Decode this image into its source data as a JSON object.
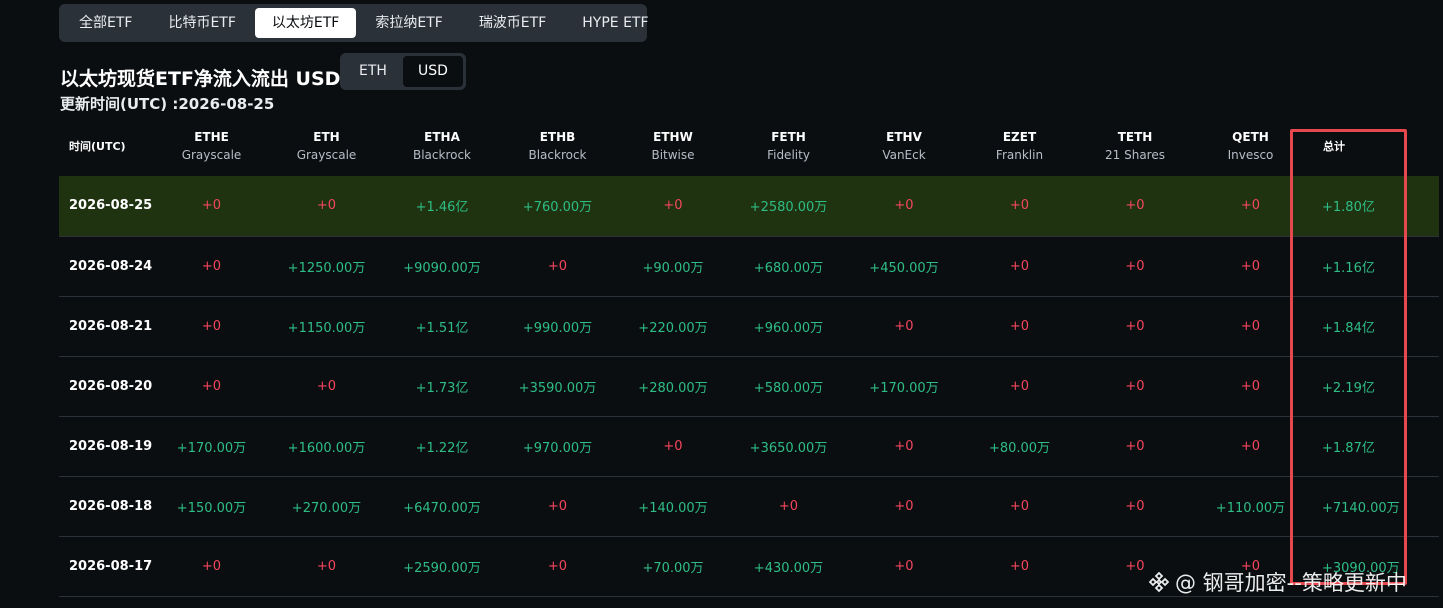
{
  "tabs": [
    {
      "label": "全部ETF",
      "active": false
    },
    {
      "label": "比特币ETF",
      "active": false
    },
    {
      "label": "以太坊ETF",
      "active": true
    },
    {
      "label": "索拉纳ETF",
      "active": false
    },
    {
      "label": "瑞波币ETF",
      "active": false
    },
    {
      "label": "HYPE ETF",
      "active": false
    }
  ],
  "title": "以太坊现货ETF净流入流出 USD",
  "currency_toggle": {
    "options": [
      "ETH",
      "USD"
    ],
    "selected": "USD"
  },
  "updated": "更新时间(UTC) :2026-08-25",
  "table": {
    "date_header": "时间(UTC)",
    "total_header": "总计",
    "columns": [
      {
        "code": "ETHE",
        "issuer": "Grayscale"
      },
      {
        "code": "ETH",
        "issuer": "Grayscale"
      },
      {
        "code": "ETHA",
        "issuer": "Blackrock"
      },
      {
        "code": "ETHB",
        "issuer": "Blackrock"
      },
      {
        "code": "ETHW",
        "issuer": "Bitwise"
      },
      {
        "code": "FETH",
        "issuer": "Fidelity"
      },
      {
        "code": "ETHV",
        "issuer": "VanEck"
      },
      {
        "code": "EZET",
        "issuer": "Franklin"
      },
      {
        "code": "TETH",
        "issuer": "21 Shares"
      },
      {
        "code": "QETH",
        "issuer": "Invesco"
      }
    ],
    "rows": [
      {
        "date": "2026-08-25",
        "values": [
          "+0",
          "+0",
          "+1.46亿",
          "+760.00万",
          "+0",
          "+2580.00万",
          "+0",
          "+0",
          "+0",
          "+0"
        ],
        "total": "+1.80亿"
      },
      {
        "date": "2026-08-24",
        "values": [
          "+0",
          "+1250.00万",
          "+9090.00万",
          "+0",
          "+90.00万",
          "+680.00万",
          "+450.00万",
          "+0",
          "+0",
          "+0"
        ],
        "total": "+1.16亿"
      },
      {
        "date": "2026-08-21",
        "values": [
          "+0",
          "+1150.00万",
          "+1.51亿",
          "+990.00万",
          "+220.00万",
          "+960.00万",
          "+0",
          "+0",
          "+0",
          "+0"
        ],
        "total": "+1.84亿"
      },
      {
        "date": "2026-08-20",
        "values": [
          "+0",
          "+0",
          "+1.73亿",
          "+3590.00万",
          "+280.00万",
          "+580.00万",
          "+170.00万",
          "+0",
          "+0",
          "+0"
        ],
        "total": "+2.19亿"
      },
      {
        "date": "2026-08-19",
        "values": [
          "+170.00万",
          "+1600.00万",
          "+1.22亿",
          "+970.00万",
          "+0",
          "+3650.00万",
          "+0",
          "+80.00万",
          "+0",
          "+0"
        ],
        "total": "+1.87亿"
      },
      {
        "date": "2026-08-18",
        "values": [
          "+150.00万",
          "+270.00万",
          "+6470.00万",
          "+0",
          "+140.00万",
          "+0",
          "+0",
          "+0",
          "+0",
          "+110.00万"
        ],
        "total": "+7140.00万"
      },
      {
        "date": "2026-08-17",
        "values": [
          "+0",
          "+0",
          "+2590.00万",
          "+0",
          "+70.00万",
          "+430.00万",
          "+0",
          "+0",
          "+0",
          "+0"
        ],
        "total": "+3090.00万"
      }
    ]
  },
  "watermark": "@ 钢哥加密--策略更新中",
  "colors": {
    "positive": "#2ebd85",
    "zero": "#f6465d",
    "highlight_row": "#1f3311",
    "annotation": "#e5484d"
  }
}
